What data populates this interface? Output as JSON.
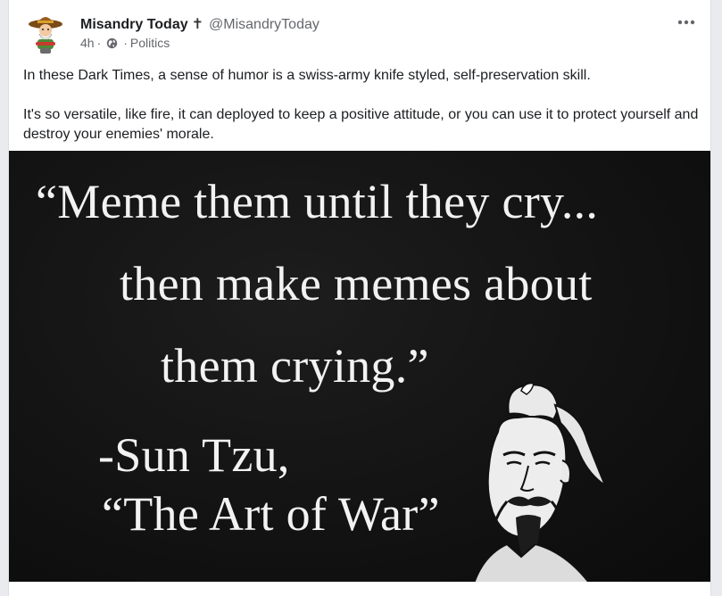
{
  "post": {
    "page_name": "Misandry Today",
    "name_icon": "latin-cross",
    "cross_glyph": "✝",
    "handle": "@MisandryToday",
    "time": "4h",
    "separator": "·",
    "privacy_icon": "globe-icon",
    "category": "Politics",
    "paragraphs": [
      "In these Dark Times, a sense of humor is a swiss-army knife styled, self-preservation skill.",
      "It's so versatile, like fire, it can deployed to keep a positive attitude, or you can use it to protect yourself and destroy your enemies' morale."
    ]
  },
  "meme": {
    "lines": [
      "“Meme them until they cry...",
      "then make memes about",
      "them crying.”",
      "-Sun Tzu,",
      "“The Art of War”"
    ]
  }
}
